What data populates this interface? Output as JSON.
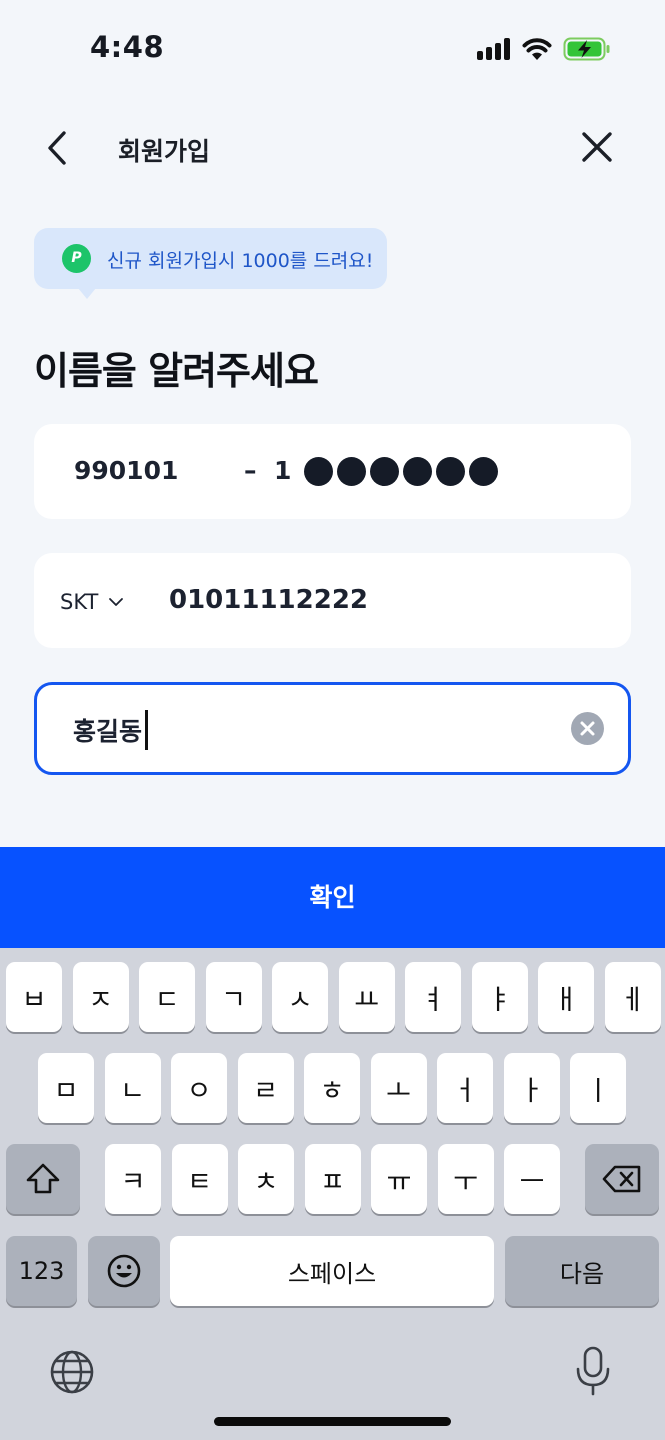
{
  "status_bar": {
    "time": "4:48"
  },
  "header": {
    "title": "회원가입"
  },
  "promo": {
    "icon_letter": "P",
    "text": "신규 회원가입시 1000를 드려요!"
  },
  "page_title": "이름을 알려주세요",
  "id_field": {
    "birth": "990101",
    "dash": "–",
    "first_digit": "1",
    "masked_count": 6
  },
  "phone_field": {
    "carrier": "SKT",
    "number": "01011112222"
  },
  "name_field": {
    "value": "홍길동"
  },
  "confirm_button": {
    "label": "확인"
  },
  "keyboard": {
    "row1": [
      "ㅂ",
      "ㅈ",
      "ㄷ",
      "ㄱ",
      "ㅅ",
      "ㅛ",
      "ㅕ",
      "ㅑ",
      "ㅐ",
      "ㅔ"
    ],
    "row2": [
      "ㅁ",
      "ㄴ",
      "ㅇ",
      "ㄹ",
      "ㅎ",
      "ㅗ",
      "ㅓ",
      "ㅏ",
      "ㅣ"
    ],
    "row3": [
      "ㅋ",
      "ㅌ",
      "ㅊ",
      "ㅍ",
      "ㅠ",
      "ㅜ",
      "ㅡ"
    ],
    "numbers_label": "123",
    "space_label": "스페이스",
    "next_label": "다음"
  },
  "icons": {
    "back": "chevron-left-icon",
    "close": "close-icon",
    "clear": "clear-circle-icon",
    "shift": "shift-icon",
    "delete": "backspace-icon",
    "emoji": "emoji-icon",
    "globe": "globe-icon",
    "mic": "microphone-icon"
  },
  "colors": {
    "accent": "#0752ff",
    "focus_border": "#1456f0",
    "promo_bg": "#d9e7fb",
    "promo_text": "#1f56c8",
    "point_green": "#1dc46a"
  }
}
